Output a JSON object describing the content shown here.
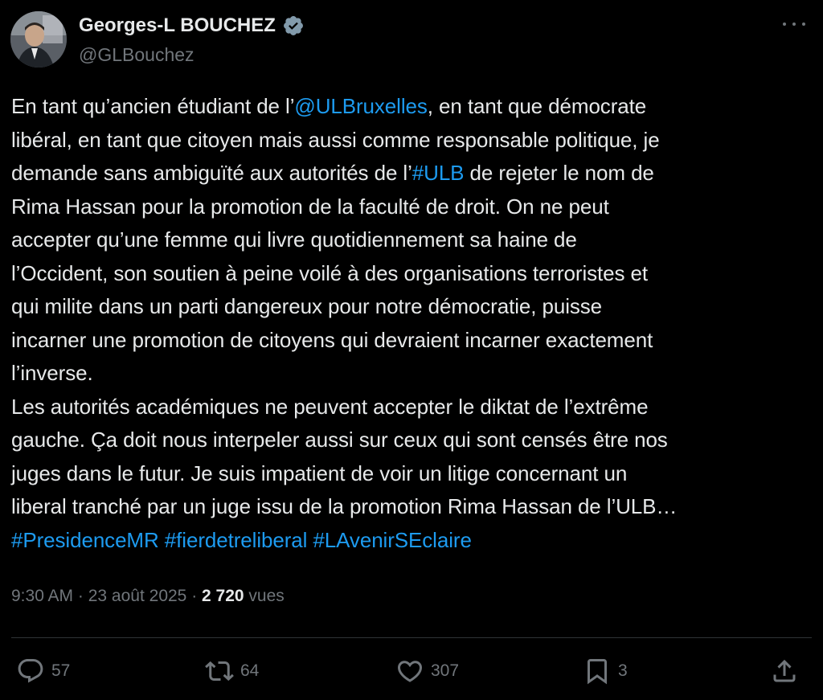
{
  "author": {
    "name": "Georges-L BOUCHEZ",
    "handle": "@GLBouchez",
    "verified": true
  },
  "tweet": {
    "lines": [
      [
        {
          "t": "En tant qu’ancien étudiant de l’"
        },
        {
          "t": "@ULBruxelles",
          "link": true
        },
        {
          "t": ", en tant que démocrate"
        }
      ],
      [
        {
          "t": "libéral, en tant que citoyen mais aussi comme responsable politique, je"
        }
      ],
      [
        {
          "t": "demande sans ambiguïté aux autorités de l’"
        },
        {
          "t": "#ULB",
          "link": true
        },
        {
          "t": " de rejeter le nom de"
        }
      ],
      [
        {
          "t": "Rima Hassan pour la promotion de la faculté de droit. On ne peut"
        }
      ],
      [
        {
          "t": "accepter qu’une femme qui livre quotidiennement sa haine de"
        }
      ],
      [
        {
          "t": "l’Occident, son soutien à peine voilé à des organisations terroristes et"
        }
      ],
      [
        {
          "t": "qui milite dans un parti dangereux pour notre démocratie, puisse"
        }
      ],
      [
        {
          "t": "incarner une promotion de citoyens qui devraient incarner exactement"
        }
      ],
      [
        {
          "t": "l’inverse."
        }
      ],
      [
        {
          "t": "Les autorités académiques ne peuvent accepter le diktat de l’extrême"
        }
      ],
      [
        {
          "t": "gauche. Ça doit nous interpeler aussi sur ceux qui sont censés être nos"
        }
      ],
      [
        {
          "t": "juges dans le futur. Je suis impatient de voir un litige concernant un"
        }
      ],
      [
        {
          "t": "liberal tranché par un juge issu de la promotion Rima Hassan de l’ULB…"
        }
      ],
      [
        {
          "t": "#PresidenceMR",
          "link": true
        },
        {
          "t": " "
        },
        {
          "t": "#fierdetreliberal",
          "link": true
        },
        {
          "t": " "
        },
        {
          "t": "#LAvenirSEclaire",
          "link": true
        }
      ]
    ]
  },
  "meta": {
    "time": "9:30 AM",
    "sep1": " · ",
    "date": "23 août 2025",
    "sep2": " · ",
    "views_count": "2 720",
    "views_label": " vues"
  },
  "actions": {
    "replies": "57",
    "reposts": "64",
    "likes": "307",
    "bookmarks": "3"
  },
  "colors": {
    "background": "#000000",
    "text": "#e7e9ea",
    "secondary": "#71767b",
    "link": "#1d9bf0",
    "verified": "#829aab"
  },
  "icons": [
    "verified-badge-icon",
    "more-icon",
    "reply-icon",
    "repost-icon",
    "like-icon",
    "bookmark-icon",
    "share-icon"
  ]
}
